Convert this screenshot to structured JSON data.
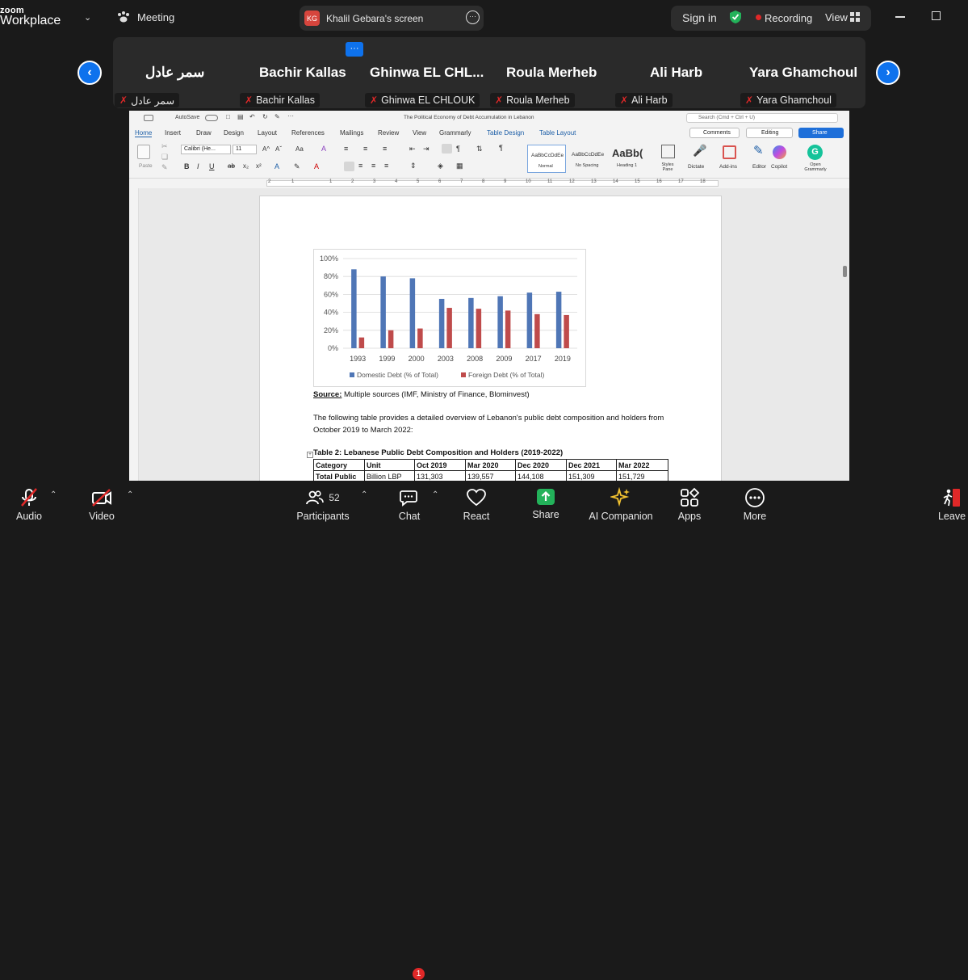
{
  "topbar": {
    "logo_top": "zoom",
    "logo_bottom": "Workplace",
    "meeting_label": "Meeting",
    "share_initials": "KG",
    "share_title": "Khalil Gebara's screen",
    "sign_in": "Sign in",
    "recording": "Recording",
    "view": "View"
  },
  "gallery": {
    "more_label": "···",
    "participants": [
      {
        "name": "سمر عادل",
        "label": "سمر عادل"
      },
      {
        "name": "Bachir Kallas",
        "label": "Bachir Kallas"
      },
      {
        "name": "Ghinwa  EL CHL...",
        "label": "Ghinwa EL CHLOUK"
      },
      {
        "name": "Roula Merheb",
        "label": "Roula Merheb"
      },
      {
        "name": "Ali Harb",
        "label": "Ali Harb"
      },
      {
        "name": "Yara Ghamchoul",
        "label": "Yara Ghamchoul"
      }
    ]
  },
  "word": {
    "autosave": "AutoSave",
    "doc_title": "The Political Economy of Debt Accumulation in Lebanon",
    "search_placeholder": "Search (Cmd + Ctrl + U)",
    "tabs": [
      "Home",
      "Insert",
      "Draw",
      "Design",
      "Layout",
      "References",
      "Mailings",
      "Review",
      "View",
      "Grammarly",
      "Table Design",
      "Table Layout"
    ],
    "comments": "Comments",
    "editing": "Editing",
    "share": "Share",
    "paste": "Paste",
    "font_name": "Calibri (He...",
    "font_size": "11",
    "styles": [
      {
        "sample": "AaBbCcDdEe",
        "name": "Normal"
      },
      {
        "sample": "AaBbCcDdEe",
        "name": "No Spacing"
      },
      {
        "sample": "AaBb(",
        "name": "Heading 1"
      }
    ],
    "styles_pane": "Styles Pane",
    "dictate": "Dictate",
    "addins": "Add-ins",
    "editor": "Editor",
    "copilot": "Copilot",
    "grammarly": "Open Grammarly",
    "ruler_marks": [
      "2",
      "1",
      "1",
      "2",
      "3",
      "4",
      "5",
      "6",
      "7",
      "8",
      "9",
      "10",
      "11",
      "12",
      "13",
      "14",
      "15",
      "16",
      "17",
      "18"
    ]
  },
  "chart_data": {
    "type": "bar",
    "categories": [
      "1993",
      "1999",
      "2000",
      "2003",
      "2008",
      "2009",
      "2017",
      "2019"
    ],
    "series": [
      {
        "name": "Domestic Debt (% of Total)",
        "color": "#4f76b6",
        "values": [
          88,
          80,
          78,
          55,
          56,
          58,
          62,
          63
        ]
      },
      {
        "name": "Foreign Debt (% of Total)",
        "color": "#bf4b4b",
        "values": [
          12,
          20,
          22,
          45,
          44,
          42,
          38,
          37
        ]
      }
    ],
    "yticks": [
      "0%",
      "20%",
      "40%",
      "60%",
      "80%",
      "100%"
    ],
    "ylim": [
      0,
      100
    ],
    "grid": true,
    "legend": "bottom"
  },
  "document": {
    "source_label": "Source:",
    "source_text": " Multiple sources (IMF, Ministry of Finance, Blominvest)",
    "para_line1": "The following table provides a detailed overview of Lebanon's public debt composition and holders from",
    "para_line2": "October 2019 to March 2022:",
    "table_title": "Table 2: Lebanese Public Debt Composition and Holders (2019-2022)",
    "table_header": [
      "Category",
      "Unit",
      "Oct 2019",
      "Mar 2020",
      "Dec 2020",
      "Dec 2021",
      "Mar 2022"
    ],
    "table_row1": [
      "Total Public",
      "Billion LBP",
      "131,303",
      "139,557",
      "144,108",
      "151,309",
      "151,729"
    ]
  },
  "bottombar": {
    "audio": "Audio",
    "video": "Video",
    "participants": "Participants",
    "participant_count": "52",
    "chat": "Chat",
    "chat_badge": "1",
    "react": "React",
    "share": "Share",
    "ai": "AI Companion",
    "apps": "Apps",
    "more": "More",
    "leave": "Leave"
  }
}
